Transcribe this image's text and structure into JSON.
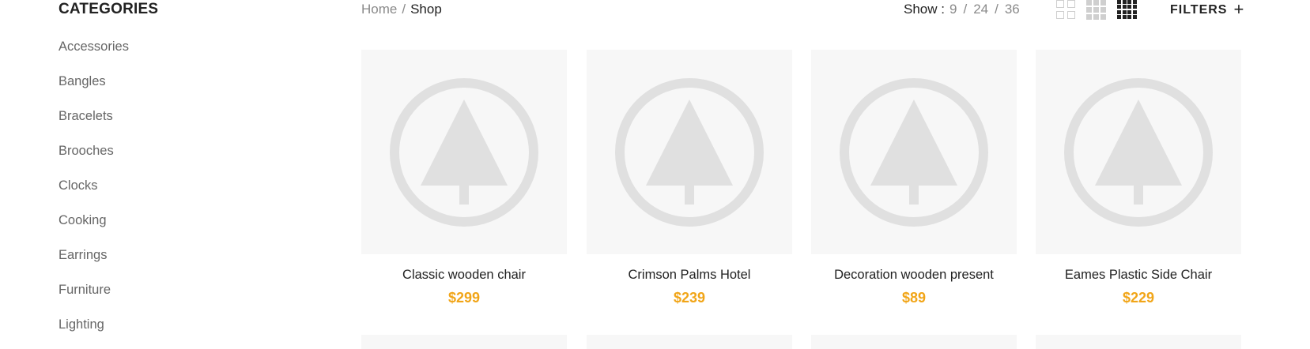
{
  "sidebar": {
    "title": "CATEGORIES",
    "items": [
      {
        "label": "Accessories"
      },
      {
        "label": "Bangles"
      },
      {
        "label": "Bracelets"
      },
      {
        "label": "Brooches"
      },
      {
        "label": "Clocks"
      },
      {
        "label": "Cooking"
      },
      {
        "label": "Earrings"
      },
      {
        "label": "Furniture"
      },
      {
        "label": "Lighting"
      }
    ]
  },
  "breadcrumb": {
    "home": "Home",
    "separator": "/",
    "current": "Shop"
  },
  "show": {
    "label": "Show :",
    "options": [
      "9",
      "24",
      "36"
    ],
    "separator": "/"
  },
  "view_modes": [
    "grid-2-icon",
    "grid-3-icon",
    "grid-4-icon"
  ],
  "active_view_mode": "grid-4-icon",
  "filters": {
    "label": "FILTERS",
    "icon": "+"
  },
  "colors": {
    "accent_price": "#f1a518",
    "placeholder_bg": "#f7f7f7",
    "placeholder_icon": "#e0e0e0"
  },
  "products": [
    {
      "name": "Classic wooden chair",
      "price": "$299"
    },
    {
      "name": "Crimson Palms Hotel",
      "price": "$239"
    },
    {
      "name": "Decoration wooden present",
      "price": "$89"
    },
    {
      "name": "Eames Plastic Side Chair",
      "price": "$229"
    }
  ]
}
